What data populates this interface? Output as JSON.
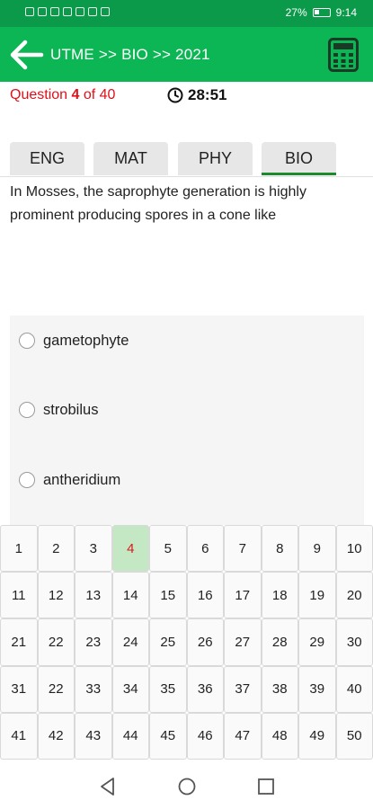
{
  "status_bar": {
    "battery_percent": "27%",
    "time": "9:14",
    "icons": [
      "signal-icon",
      "wifi-icon",
      "hotspot-icon",
      "image-icon",
      "youtube-icon",
      "message-icon",
      "whatsapp-icon"
    ]
  },
  "app_bar": {
    "title": "UTME >> BIO >> 2021",
    "back_icon": "arrow-left-icon",
    "calculator_icon": "calculator-icon",
    "color": "#0db655"
  },
  "question_header": {
    "label_prefix": "Question",
    "current": "4",
    "label_of": "of",
    "total": "40",
    "timer": "28:51",
    "label_color": "#e0101a"
  },
  "tabs": [
    {
      "label": "ENG",
      "active": false
    },
    {
      "label": "MAT",
      "active": false
    },
    {
      "label": "PHY",
      "active": false
    },
    {
      "label": "BIO",
      "active": true
    }
  ],
  "question": {
    "text": "In Mosses, the saprophyte generation is highly prominent producing spores in a cone like"
  },
  "options": [
    {
      "label": "gametophyte"
    },
    {
      "label": "strobilus"
    },
    {
      "label": "antheridium"
    }
  ],
  "grid": {
    "numbers": [
      "1",
      "2",
      "3",
      "4",
      "5",
      "6",
      "7",
      "8",
      "9",
      "10",
      "11",
      "12",
      "13",
      "14",
      "15",
      "16",
      "17",
      "18",
      "19",
      "20",
      "21",
      "22",
      "23",
      "24",
      "25",
      "26",
      "27",
      "28",
      "29",
      "30",
      "31",
      "22",
      "33",
      "34",
      "35",
      "36",
      "37",
      "38",
      "39",
      "40",
      "41",
      "42",
      "43",
      "44",
      "45",
      "46",
      "47",
      "48",
      "49",
      "50"
    ],
    "current_index": 3,
    "current_bg": "#c4e8c4"
  },
  "nav_bar": {
    "back": "nav-back-icon",
    "home": "nav-home-icon",
    "recents": "nav-recents-icon"
  }
}
